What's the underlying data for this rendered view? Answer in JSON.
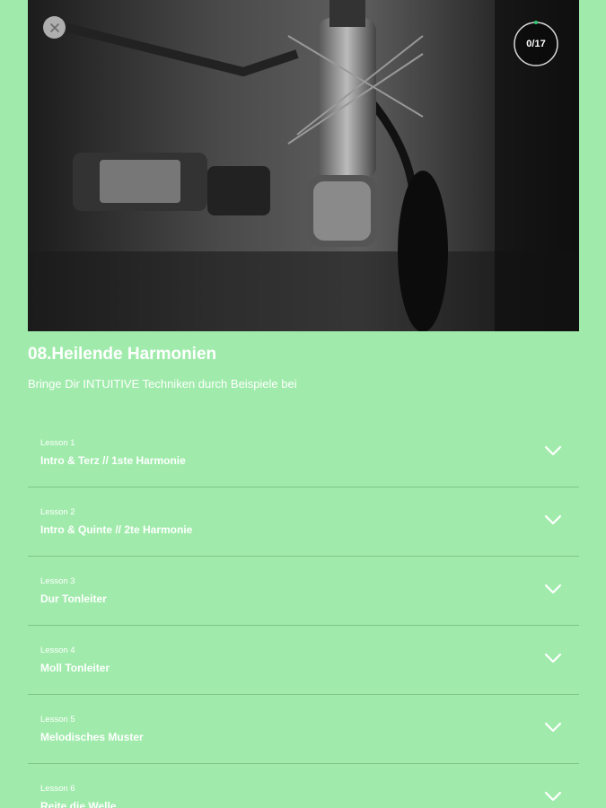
{
  "progress": {
    "label": "0/17",
    "completed": 0,
    "total": 17
  },
  "course": {
    "title": "08.Heilende Harmonien",
    "subtitle": "Bringe Dir INTUITIVE Techniken durch Beispiele bei"
  },
  "lessons": [
    {
      "number": "Lesson 1",
      "title": "Intro & Terz // 1ste Harmonie"
    },
    {
      "number": "Lesson 2",
      "title": "Intro & Quinte // 2te Harmonie"
    },
    {
      "number": "Lesson 3",
      "title": "Dur Tonleiter"
    },
    {
      "number": "Lesson 4",
      "title": "Moll Tonleiter"
    },
    {
      "number": "Lesson 5",
      "title": "Melodisches Muster"
    },
    {
      "number": "Lesson 6",
      "title": "Reite die Welle"
    }
  ],
  "icons": {
    "close": "close-icon",
    "expand": "chevron-down-icon"
  },
  "colors": {
    "background": "#a0ebab",
    "divider": "#7fc48c",
    "text": "#ffffff",
    "progress_accent": "#2ecc71"
  }
}
